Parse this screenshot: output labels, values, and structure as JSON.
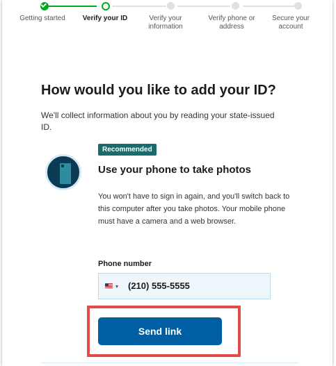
{
  "steps": [
    {
      "label": "Getting started",
      "state": "done"
    },
    {
      "label": "Verify your ID",
      "state": "current"
    },
    {
      "label": "Verify your information",
      "state": "todo"
    },
    {
      "label": "Verify phone or address",
      "state": "todo"
    },
    {
      "label": "Secure your account",
      "state": "todo"
    }
  ],
  "page": {
    "title": "How would you like to add your ID?",
    "intro": "We'll collect information about you by reading your state-issued ID."
  },
  "option": {
    "badge": "Recommended",
    "heading": "Use your phone to take photos",
    "description": "You won't have to sign in again, and you'll switch back to this computer after you take photos. Your mobile phone must have a camera and a web browser.",
    "icon": "phone-camera-icon"
  },
  "phone": {
    "label": "Phone number",
    "country_flag": "us-flag-icon",
    "value": "(210) 555-5555"
  },
  "actions": {
    "send_link": "Send link"
  },
  "colors": {
    "progress_done": "#00a91c",
    "primary": "#005ea2",
    "badge": "#1a6b6b",
    "highlight": "#e34b4b"
  }
}
